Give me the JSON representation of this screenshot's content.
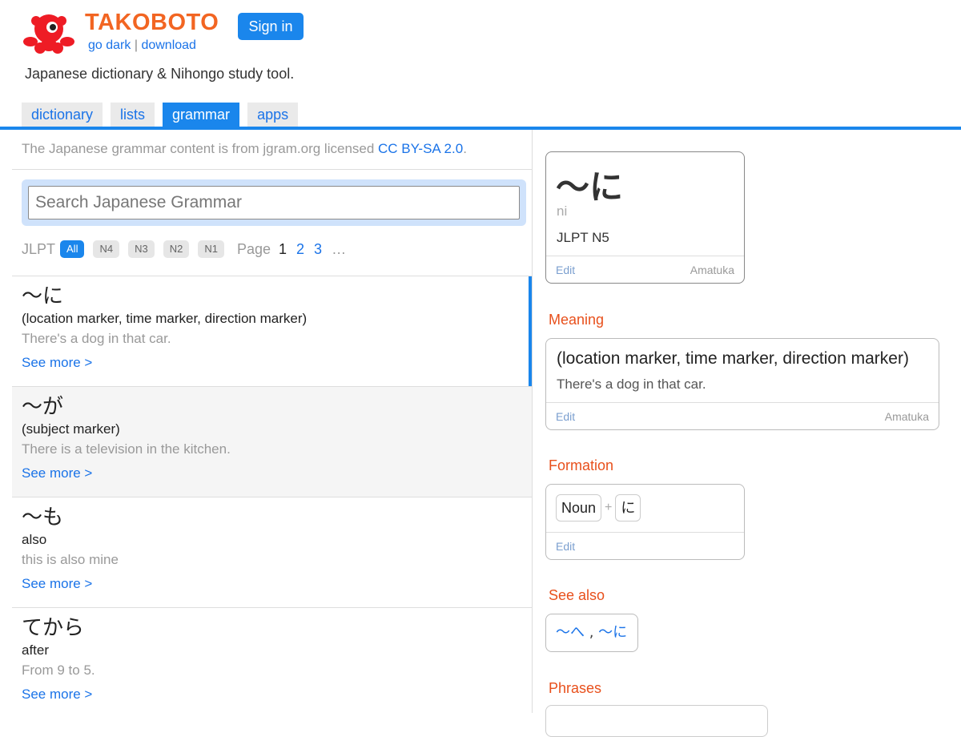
{
  "header": {
    "brand": "TAKOBOTO",
    "go_dark": "go dark",
    "separator": "|",
    "download": "download",
    "sign_in": "Sign in",
    "tagline": "Japanese dictionary & Nihongo study tool."
  },
  "tabs": [
    {
      "label": "dictionary",
      "active": false
    },
    {
      "label": "lists",
      "active": false
    },
    {
      "label": "grammar",
      "active": true
    },
    {
      "label": "apps",
      "active": false
    }
  ],
  "credit": {
    "text": "The Japanese grammar content is from jgram.org licensed ",
    "link": "CC BY-SA 2.0",
    "end": "."
  },
  "search": {
    "placeholder": "Search Japanese Grammar",
    "value": ""
  },
  "filter": {
    "label": "JLPT",
    "levels": [
      "All",
      "N4",
      "N3",
      "N2",
      "N1"
    ],
    "active_level": "All",
    "page_label": "Page",
    "pages": [
      "1",
      "2",
      "3"
    ],
    "current_page": "1",
    "more": "…"
  },
  "grammar_list": [
    {
      "title": "〜に",
      "meaning": "(location marker, time marker, direction marker)",
      "example": "There's a dog in that car.",
      "more": "See more >"
    },
    {
      "title": "〜が",
      "meaning": "(subject marker)",
      "example": "There is a television in the kitchen.",
      "more": "See more >"
    },
    {
      "title": "〜も",
      "meaning": "also",
      "example": "this is also mine",
      "more": "See more >"
    },
    {
      "title": "てから",
      "meaning": "after",
      "example": "From 9 to 5.",
      "more": "See more >"
    }
  ],
  "detail": {
    "title": "〜に",
    "reading": "ni",
    "level": "JLPT N5",
    "edit": "Edit",
    "author": "Amatuka",
    "sections": {
      "meaning": "Meaning",
      "formation": "Formation",
      "see_also": "See also",
      "phrases": "Phrases"
    },
    "meaning_text": "(location marker, time marker, direction marker)",
    "meaning_example": "There's a dog in that car.",
    "formation_parts": [
      "Noun",
      "に"
    ],
    "formation_plus": "+",
    "see_also_items": [
      "〜へ",
      "〜に"
    ],
    "see_also_sep": " , "
  },
  "colors": {
    "accent": "#1a86ec",
    "brand": "#f26522",
    "section": "#e8501c"
  }
}
